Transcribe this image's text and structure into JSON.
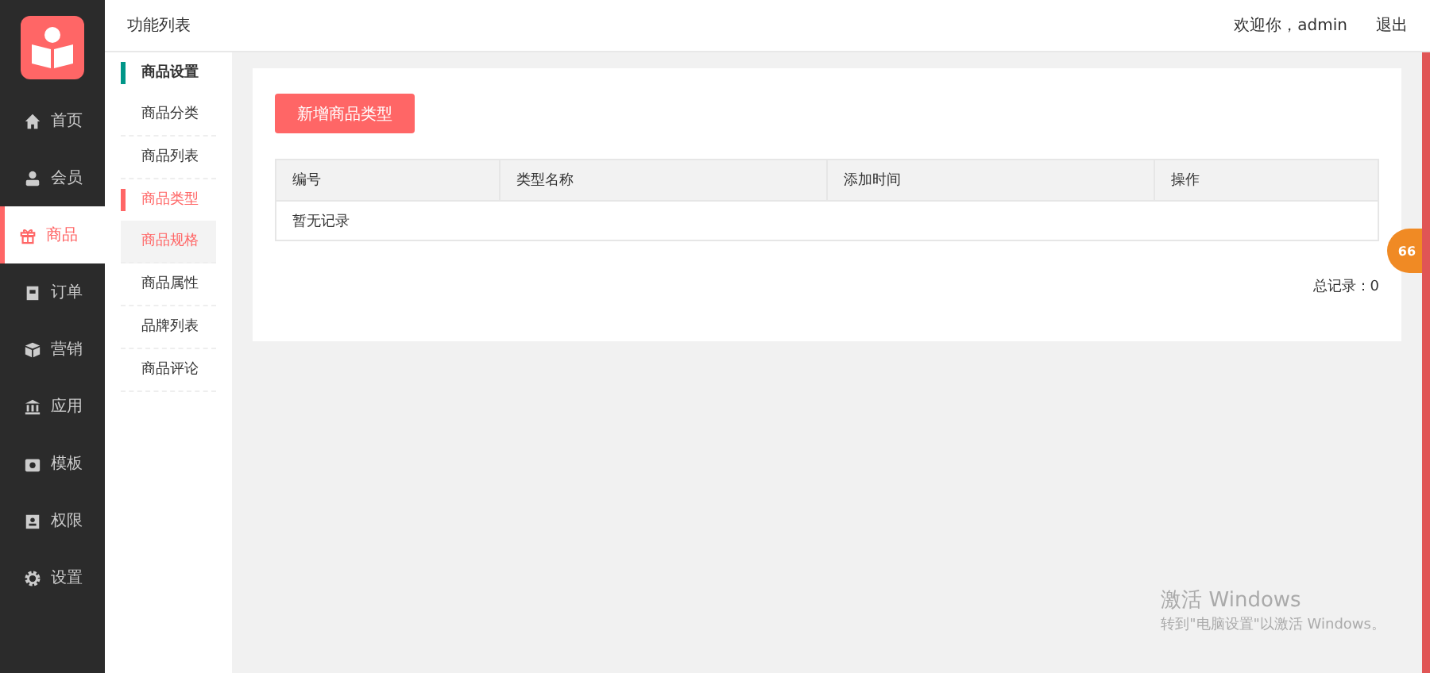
{
  "sidebar": {
    "items": [
      {
        "label": "首页",
        "selected": false
      },
      {
        "label": "会员",
        "selected": false
      },
      {
        "label": "商品",
        "selected": true
      },
      {
        "label": "订单",
        "selected": false
      },
      {
        "label": "营销",
        "selected": false
      },
      {
        "label": "应用",
        "selected": false
      },
      {
        "label": "模板",
        "selected": false
      },
      {
        "label": "权限",
        "selected": false
      },
      {
        "label": "设置",
        "selected": false
      }
    ]
  },
  "submenu": {
    "title": "功能列表",
    "items": [
      {
        "kind": "heading",
        "label": "商品设置",
        "color": "#009688",
        "selected": false
      },
      {
        "kind": "link",
        "label": "商品分类",
        "selected": false
      },
      {
        "kind": "link",
        "label": "商品列表",
        "selected": false
      },
      {
        "kind": "heading",
        "label": "商品类型",
        "color": "#ff6666",
        "selected": true
      },
      {
        "kind": "link",
        "label": "商品规格",
        "selected": true
      },
      {
        "kind": "link",
        "label": "商品属性",
        "selected": false
      },
      {
        "kind": "link",
        "label": "品牌列表",
        "selected": false
      },
      {
        "kind": "link",
        "label": "商品评论",
        "selected": false
      }
    ]
  },
  "header": {
    "welcome": "欢迎你，admin",
    "logout": "退出"
  },
  "add_button": "新增商品类型",
  "table": {
    "columns": [
      "编号",
      "类型名称",
      "添加时间",
      "操作"
    ],
    "empty": "暂无记录"
  },
  "total": "总记录：0",
  "floating_badge": "66",
  "activation": {
    "title": "激活 Windows",
    "text": "转到\"电脑设置\"以激活 Windows。"
  }
}
